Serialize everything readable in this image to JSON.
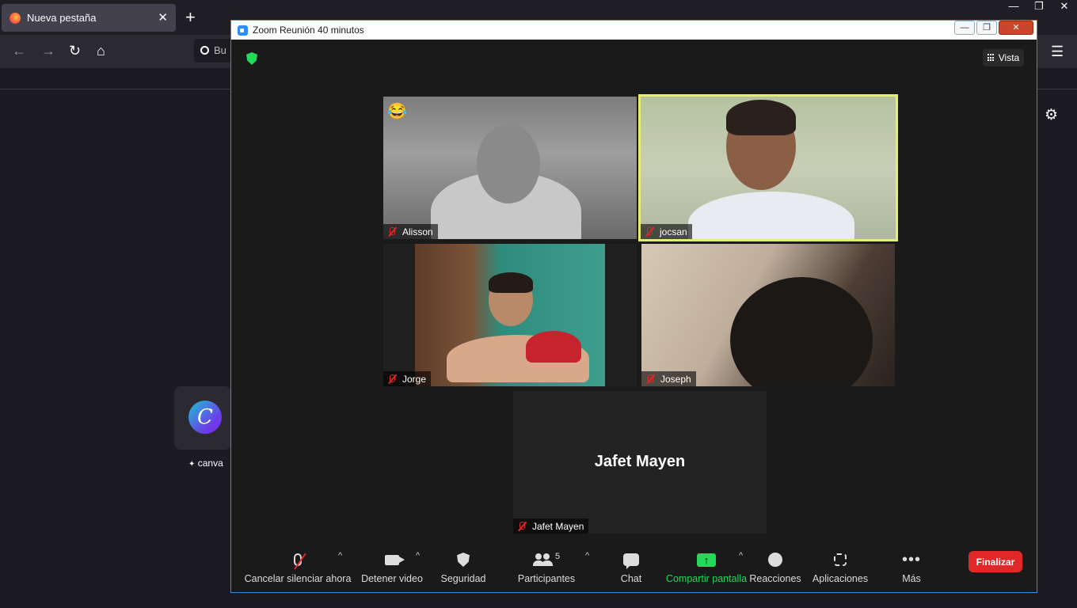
{
  "browser": {
    "tab_title": "Nueva pestaña",
    "tab_close": "✕",
    "new_tab": "+",
    "window_controls": [
      "—",
      "❐",
      "✕"
    ],
    "nav": {
      "back": "←",
      "forward": "→",
      "reload": "↻",
      "home": "⌂",
      "menu": "☰"
    },
    "search_partial": "Bu",
    "settings_icon": "⚙",
    "shortcut": {
      "letter": "C",
      "label": "canva",
      "sponsored_icon": "✦"
    }
  },
  "zoom": {
    "title": "Zoom Reunión 40 minutos",
    "window_buttons": [
      "—",
      "❐",
      "✕"
    ],
    "view_label": "Vista",
    "participants": [
      {
        "name": "Alisson",
        "reaction": "😂"
      },
      {
        "name": "jocsan"
      },
      {
        "name": "Jorge"
      },
      {
        "name": "Joseph"
      },
      {
        "name": "Jafet Mayen",
        "display_name": "Jafet Mayen"
      }
    ],
    "toolbar": {
      "mute": "Cancelar silenciar ahora",
      "video": "Detener video",
      "security": "Seguridad",
      "participants": "Participantes",
      "participants_count": "5",
      "chat": "Chat",
      "share": "Compartir pantalla",
      "share_arrow": "↑",
      "reactions": "Reacciones",
      "apps": "Aplicaciones",
      "more": "Más",
      "more_dots": "•••",
      "end": "Finalizar",
      "caret": "^"
    },
    "colors": {
      "active_speaker_border": "#e6ee6f",
      "end_button": "#e02828",
      "share_green": "#23d959",
      "muted_red": "#e02828"
    }
  }
}
